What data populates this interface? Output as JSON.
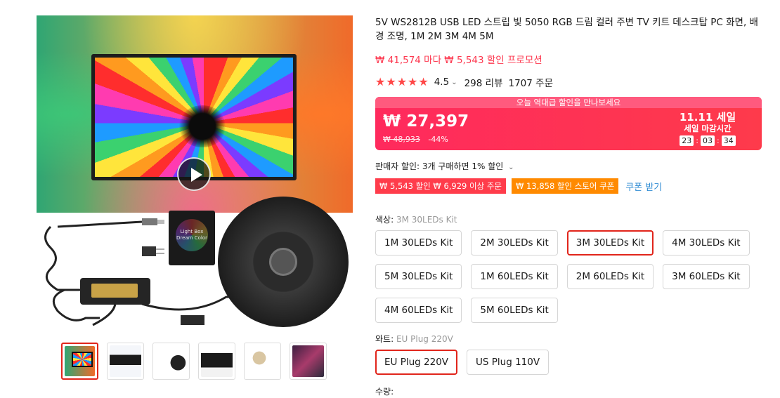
{
  "product": {
    "title": "5V WS2812B USB LED 스트립 빛 5050 RGB 드림 컬러 주변 TV 키트 데스크탑 PC 화면, 배경 조명, 1M 2M 3M 4M 5M",
    "promo_line": "₩ 41,574 마다 ₩ 5,543 할인 프로모션"
  },
  "gallery": {
    "box_label": "Light Box Dream Color",
    "thumbnails": [
      "thumb-1",
      "thumb-2",
      "thumb-3",
      "thumb-4",
      "thumb-5",
      "thumb-6"
    ]
  },
  "rating": {
    "score": "4.5",
    "stars": 5,
    "reviews": "298 리뷰",
    "orders": "1707 주문"
  },
  "price": {
    "banner": "오늘 역대급 할인을 만나보세요",
    "current": "₩ 27,397",
    "original": "₩ 48,933",
    "discount": "-44%",
    "sale_title": "11.11 세일",
    "sale_sub": "세일 마감시간",
    "timer": [
      "23",
      "03",
      "34"
    ]
  },
  "seller": {
    "discount_text": "판매자 할인: 3개 구매하면 1% 할인",
    "coupons": [
      "₩ 5,543 할인 ₩ 6,929 이상 주문",
      "₩ 13,858 할인 스토어 쿠폰"
    ],
    "coupon_link": "쿠폰 받기"
  },
  "options": {
    "color_label": "색상:",
    "color_value": "3M 30LEDs Kit",
    "colors": [
      "1M 30LEDs Kit",
      "2M 30LEDs Kit",
      "3M 30LEDs Kit",
      "4M 30LEDs Kit",
      "5M 30LEDs Kit",
      "1M 60LEDs Kit",
      "2M 60LEDs Kit",
      "3M 60LEDs Kit",
      "4M 60LEDs Kit",
      "5M 60LEDs Kit"
    ],
    "plug_label": "와트:",
    "plug_value": "EU Plug 220V",
    "plugs": [
      "EU Plug 220V",
      "US Plug 110V"
    ],
    "qty_label": "수량:"
  },
  "colors": {
    "accent": "#e1251b",
    "price_bg": "#fe3a4b",
    "promo": "#fd384f",
    "coupon_orange": "#ff8a00",
    "link": "#2e8bd3"
  }
}
